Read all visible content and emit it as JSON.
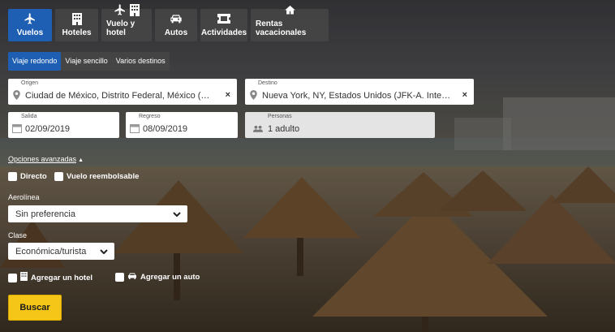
{
  "tabs": [
    {
      "label": "Vuelos",
      "icon": "plane-icon",
      "active": true
    },
    {
      "label": "Hoteles",
      "icon": "building-icon"
    },
    {
      "label": "Vuelo y hotel",
      "icon": "plane-building-icon"
    },
    {
      "label": "Autos",
      "icon": "car-icon"
    },
    {
      "label": "Actividades",
      "icon": "ticket-icon"
    },
    {
      "label": "Rentas vacacionales",
      "icon": "house-icon"
    }
  ],
  "trip_types": [
    {
      "label": "Viaje redondo",
      "active": true
    },
    {
      "label": "Viaje sencillo"
    },
    {
      "label": "Varios destinos"
    }
  ],
  "origin": {
    "label": "Origen",
    "value": "Ciudad de México, Distrito Federal, México (…"
  },
  "destination": {
    "label": "Destino",
    "value": "Nueva York, NY, Estados Unidos (JFK-A. Inte…"
  },
  "departure": {
    "label": "Salida",
    "value": "02/09/2019"
  },
  "return": {
    "label": "Regreso",
    "value": "08/09/2019"
  },
  "passengers": {
    "label": "Personas",
    "value": "1 adulto"
  },
  "advanced_options": "Opciones avanzadas",
  "checks": {
    "direct": "Directo",
    "refundable": "Vuelo reembolsable",
    "add_hotel": "Agregar un hotel",
    "add_car": "Agregar un auto"
  },
  "airline": {
    "label": "Aerolínea",
    "value": "Sin preferencia"
  },
  "class": {
    "label": "Clase",
    "value": "Económica/turista"
  },
  "search_button": "Buscar",
  "colors": {
    "accent": "#1e5fb4",
    "cta": "#f5c518"
  }
}
